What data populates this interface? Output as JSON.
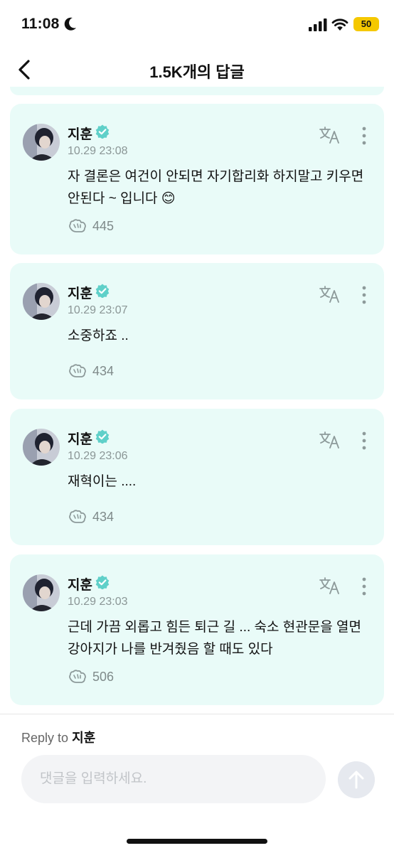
{
  "status_bar": {
    "time": "11:08",
    "battery_level": "50",
    "icons": [
      "moon-icon",
      "signal-icon",
      "wifi-icon",
      "battery-icon"
    ],
    "battery_color": "#f5c800"
  },
  "nav": {
    "title": "1.5K개의 답글",
    "back_icon": "chevron-left-icon"
  },
  "colors": {
    "card_background": "#e9fbf8",
    "verified_badge": "#5fd0c9",
    "muted_text": "#8b9696",
    "icon_gray": "#8d9a9a"
  },
  "comments": [
    {
      "author": "지훈",
      "verified": true,
      "date": "10.29 23:08",
      "text": "자 결론은 여건이 안되면 자기합리화 하지말고 키우면 안된다 ~ 입니다 😊",
      "likes": "445"
    },
    {
      "author": "지훈",
      "verified": true,
      "date": "10.29 23:07",
      "text": "소중하죠 ..",
      "likes": "434"
    },
    {
      "author": "지훈",
      "verified": true,
      "date": "10.29 23:06",
      "text": "재혁이는 ....",
      "likes": "434"
    },
    {
      "author": "지훈",
      "verified": true,
      "date": "10.29 23:03",
      "text": "근데 가끔 외롭고 힘든 퇴근 길 ... 숙소 현관문을 열면 강아지가 나를 반겨줬음 할 때도 있다",
      "likes": "506"
    }
  ],
  "reply": {
    "label": "Reply to",
    "target": "지훈",
    "placeholder": "댓글을 입력하세요.",
    "value": ""
  }
}
